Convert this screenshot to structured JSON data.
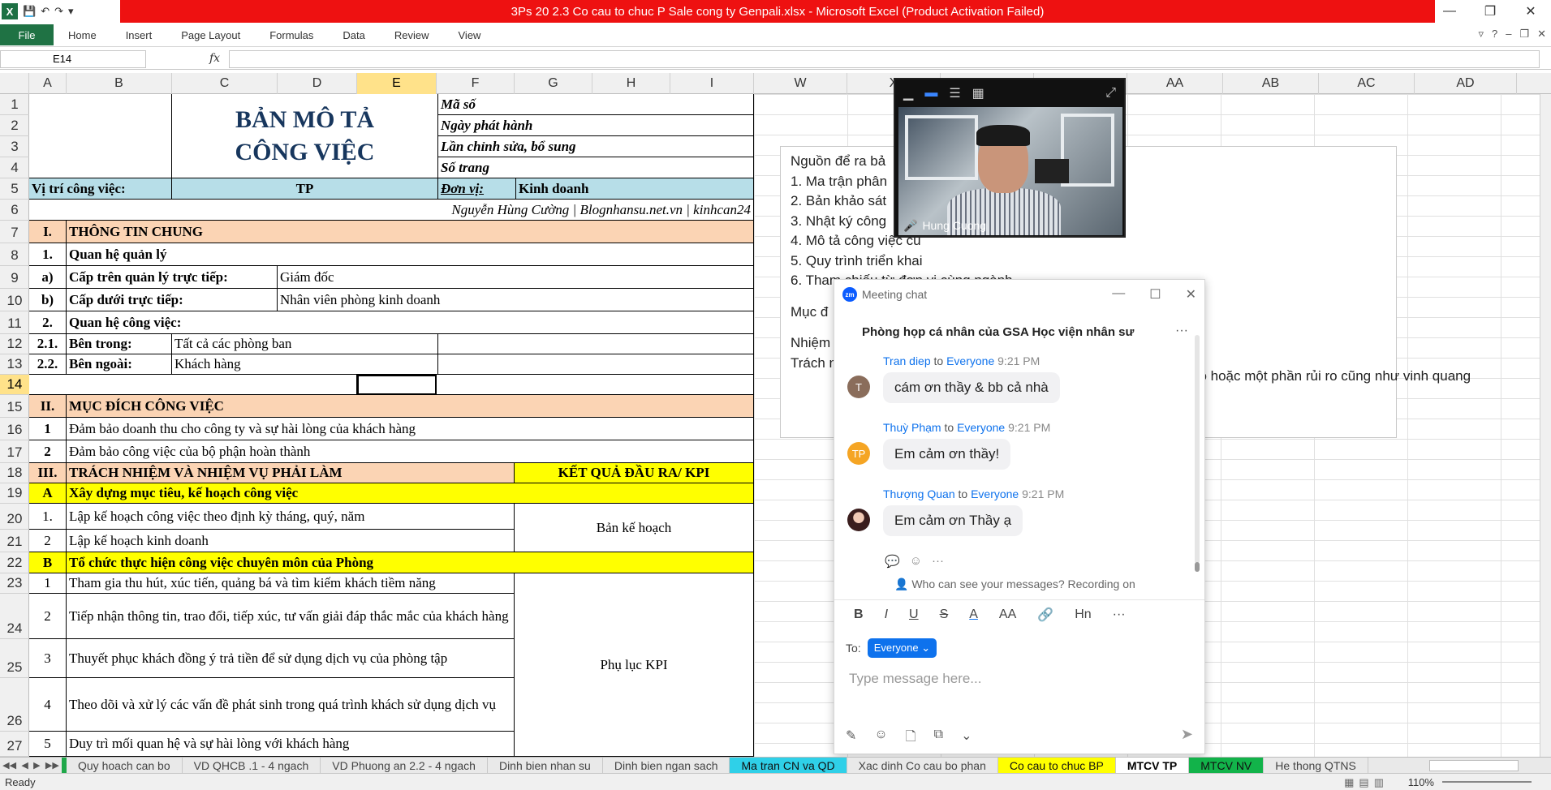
{
  "window": {
    "title": "3Ps 20 2.3 Co cau to chuc P Sale cong ty Genpali.xlsx  -  Microsoft Excel (Product Activation Failed)"
  },
  "ribbon": {
    "file": "File",
    "tabs": [
      "Home",
      "Insert",
      "Page Layout",
      "Formulas",
      "Data",
      "Review",
      "View"
    ]
  },
  "formula_bar": {
    "name_box": "E14",
    "fx": "fx",
    "value": ""
  },
  "columns": {
    "left": [
      "A",
      "B",
      "C",
      "D",
      "E",
      "F",
      "G",
      "H",
      "I"
    ],
    "right": [
      "W",
      "X",
      "Y",
      "Z",
      "AA",
      "AB",
      "AC",
      "AD"
    ]
  },
  "rows": [
    "1",
    "2",
    "3",
    "4",
    "5",
    "6",
    "7",
    "8",
    "9",
    "10",
    "11",
    "12",
    "13",
    "14",
    "15",
    "16",
    "17",
    "18",
    "19",
    "20",
    "21",
    "22",
    "23",
    "24",
    "25",
    "26",
    "27"
  ],
  "sheet": {
    "title1": "BẢN MÔ TẢ",
    "title2": "CÔNG VIỆC",
    "ma_so": "Mã số",
    "ngay_phat_hanh": "Ngày phát hành",
    "lan_chinh_sua": "Lần chỉnh sửa, bổ sung",
    "so_trang": "Số trang",
    "vi_tri_label": "Vị trí công việc:",
    "vi_tri_value": "TP",
    "don_vi_label": "Đơn vị:",
    "don_vi_value": "Kinh doanh",
    "author": "Nguyễn Hùng Cường | Blognhansu.net.vn | kinhcan24",
    "s1_num": "I.",
    "s1_title": "THÔNG TIN CHUNG",
    "r8_num": "1.",
    "r8_text": "Quan hệ quản lý",
    "r9_num": "a)",
    "r9_label": "Cấp trên quản lý trực tiếp:",
    "r9_value": "Giám đốc",
    "r10_num": "b)",
    "r10_label": "Cấp dưới trực tiếp:",
    "r10_value": "Nhân viên phòng kinh doanh",
    "r11_num": "2.",
    "r11_text": "Quan hệ công việc:",
    "r12_num": "2.1.",
    "r12_label": "Bên trong:",
    "r12_value": "Tất cả các phòng ban",
    "r13_num": "2.2.",
    "r13_label": "Bên ngoài:",
    "r13_value": "Khách hàng",
    "s2_num": "II.",
    "s2_title": "MỤC ĐÍCH CÔNG VIỆC",
    "r16_num": "1",
    "r16_text": "Đảm bảo doanh thu cho công ty và sự hài lòng của khách hàng",
    "r17_num": "2",
    "r17_text": "Đảm bảo công việc của bộ phận hoàn thành",
    "s3_num": "III.",
    "s3_title": "TRÁCH NHIỆM VÀ NHIỆM VỤ PHẢI LÀM",
    "s3_kpi": "KẾT QUẢ ĐẦU RA/ KPI",
    "a_num": "A",
    "a_title": "Xây dựng mục tiêu, kế hoạch công việc",
    "r20_num": "1.",
    "r20_text": "Lập kế hoạch công việc theo định kỳ tháng, quý, năm",
    "r21_num": "2",
    "r21_text": "Lập kế hoạch kinh doanh",
    "a_result": "Bản kế hoạch",
    "b_num": "B",
    "b_title": "Tổ chức thực hiện công việc chuyên môn của Phòng",
    "r23_num": "1",
    "r23_text": "Tham gia thu hút, xúc tiến, quảng bá và tìm kiếm khách tiềm năng",
    "r24_num": "2",
    "r24_text": "Tiếp nhận thông tin, trao đổi, tiếp xúc, tư vấn giải đáp thắc mắc của khách hàng",
    "r25_num": "3",
    "r25_text": "Thuyết phục khách đồng ý trả tiền để sử dụng dịch vụ của phòng tập",
    "r26_num": "4",
    "r26_text": "Theo dõi và xử lý các vấn đề phát sinh trong quá trình khách sử dụng dịch vụ",
    "r27_num": "5",
    "r27_text": "Duy trì mối quan hệ và sự hài lòng với khách hàng",
    "b_result": "Phụ lục KPI"
  },
  "textbox": {
    "lines": [
      "Nguồn để ra bả",
      "1. Ma trận phân",
      "2. Bản khảo sát",
      "3. Nhật ký công",
      "4. Mô tả công việc cũ",
      "5. Quy trình triển khai",
      "6. Tham chiếu từ đơn vị cùng ngành",
      "",
      "Mục đ",
      "",
      "Nhiệm",
      "Trách n"
    ],
    "overflow": "độ  hoặc một phần rủi ro cũng như vinh quang"
  },
  "video": {
    "name": "Hung Cuong"
  },
  "chat": {
    "header": "Meeting chat",
    "zm": "zm",
    "title": "Phòng họp cá nhân của GSA Học viện nhân sư",
    "messages": [
      {
        "sender": "Tran diep",
        "to": "to",
        "audience": "Everyone",
        "time": "9:21 PM",
        "text": "cám ơn thầy & bb cả nhà",
        "avatar": "T",
        "color": "#8a6d5b"
      },
      {
        "sender": "Thuỳ Phạm",
        "to": "to",
        "audience": "Everyone",
        "time": "9:21 PM",
        "text": "Em cảm ơn thầy!",
        "avatar": "TP",
        "color": "#f5a524"
      },
      {
        "sender": "Thượng Quan",
        "to": "to",
        "audience": "Everyone",
        "time": "9:21 PM",
        "text": "Em cảm ơn Thầy ạ",
        "avatar": "",
        "color": "#b84a4a"
      }
    ],
    "who_can_see": "Who can see your messages? Recording on",
    "to_label": "To:",
    "recipient": "Everyone",
    "placeholder": "Type message here..."
  },
  "sheet_tabs": [
    "Quy hoach can bo",
    "VD QHCB .1 - 4 ngach",
    "VD Phuong an 2.2 - 4 ngach",
    "Dinh bien nhan su",
    "Dinh bien ngan sach",
    "Ma tran CN va QD",
    "Xac dinh Co cau bo phan",
    "Co cau to chuc BP",
    "MTCV TP",
    "MTCV NV",
    "He thong QTNS"
  ],
  "status": {
    "ready": "Ready",
    "zoom": "110%"
  }
}
